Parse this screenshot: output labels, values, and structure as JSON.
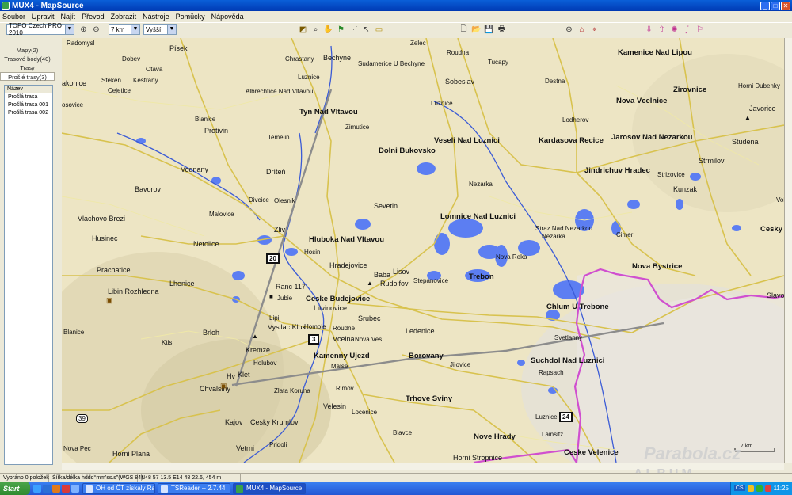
{
  "window": {
    "title": "MUX4 - MapSource",
    "buttons": [
      "_",
      "□",
      "✕"
    ]
  },
  "menu": [
    "Soubor",
    "Upravit",
    "Najít",
    "Převod",
    "Zobrazit",
    "Nástroje",
    "Pomůcky",
    "Nápověda"
  ],
  "toolbar": {
    "map_product": "TOPO Czech PRO 2010",
    "zoom": "7 km",
    "detail": "Vyšší",
    "tools": [
      "zoom-in",
      "zoom-out",
      "map-tool",
      "zoom-tool",
      "hand-tool",
      "waypoint-tool",
      "route-tool",
      "select-tool",
      "measure-tool"
    ],
    "file_tools": [
      "new",
      "open",
      "save",
      "print"
    ],
    "find_tools": [
      "find",
      "find-place",
      "find-nearest"
    ],
    "device_tools": [
      "receive",
      "send",
      "tracks",
      "routes",
      "waypoints"
    ]
  },
  "left_panel": {
    "tabs": [
      "Mapy(2)",
      "Trasové body(40)",
      "Trasy",
      "Prošlé trasy(3)"
    ],
    "list_header": "Název",
    "items": [
      "Prošlá trasa",
      "Prošlá trasa 001",
      "Prošlá trasa 002"
    ]
  },
  "map": {
    "labels": [
      {
        "text": "Radomysl",
        "cls": ""
      },
      {
        "text": "Písek",
        "cls": "big"
      },
      {
        "text": "Dobev",
        "cls": ""
      },
      {
        "text": "Otava",
        "cls": ""
      },
      {
        "text": "Steken",
        "cls": ""
      },
      {
        "text": "Kestrany",
        "cls": ""
      },
      {
        "text": "Cejetice",
        "cls": ""
      },
      {
        "text": "akonice",
        "cls": "big"
      },
      {
        "text": "osovice",
        "cls": ""
      },
      {
        "text": "Blanice",
        "cls": ""
      },
      {
        "text": "Protivin",
        "cls": "big"
      },
      {
        "text": "Temelin",
        "cls": ""
      },
      {
        "text": "Vodnany",
        "cls": "big"
      },
      {
        "text": "Dríteň",
        "cls": "big"
      },
      {
        "text": "Bavorov",
        "cls": "big"
      },
      {
        "text": "Vlachovo Brezi",
        "cls": "big"
      },
      {
        "text": "Husinec",
        "cls": "big"
      },
      {
        "text": "Netolice",
        "cls": "big"
      },
      {
        "text": "Malovice",
        "cls": ""
      },
      {
        "text": "Divcice",
        "cls": ""
      },
      {
        "text": "Olesnik",
        "cls": ""
      },
      {
        "text": "Zliv",
        "cls": "big"
      },
      {
        "text": "Prachatice",
        "cls": "big"
      },
      {
        "text": "Lhenice",
        "cls": "big"
      },
      {
        "text": "Libin Rozhledna",
        "cls": "big"
      },
      {
        "text": "Ranc 117",
        "cls": "big"
      },
      {
        "text": "Jubie",
        "cls": ""
      },
      {
        "text": "Lipi",
        "cls": ""
      },
      {
        "text": "Vysilac Kluk",
        "cls": "big"
      },
      {
        "text": "Brloh",
        "cls": "big"
      },
      {
        "text": "Blanice",
        "cls": ""
      },
      {
        "text": "Ktis",
        "cls": ""
      },
      {
        "text": "Kremze",
        "cls": "big"
      },
      {
        "text": "Holubov",
        "cls": ""
      },
      {
        "text": "Klet",
        "cls": "big"
      },
      {
        "text": "Hv",
        "cls": "big"
      },
      {
        "text": "Chvalsiny",
        "cls": "big"
      },
      {
        "text": "Zlata Koruna",
        "cls": ""
      },
      {
        "text": "Kajov",
        "cls": "big"
      },
      {
        "text": "Cesky Krumlov",
        "cls": "big"
      },
      {
        "text": "Vetrni",
        "cls": "big"
      },
      {
        "text": "Pridoli",
        "cls": ""
      },
      {
        "text": "Horni Plana",
        "cls": "big"
      },
      {
        "text": "Nova Pec",
        "cls": ""
      },
      {
        "text": "Chrastany",
        "cls": ""
      },
      {
        "text": "Bechyne",
        "cls": "big"
      },
      {
        "text": "Sudamerice U Bechyne",
        "cls": ""
      },
      {
        "text": "Luznice",
        "cls": ""
      },
      {
        "text": "Albrechtice Nad Vltavou",
        "cls": ""
      },
      {
        "text": "Tyn Nad Vltavou",
        "cls": "bold"
      },
      {
        "text": "Zimutice",
        "cls": ""
      },
      {
        "text": "Dolni Bukovsko",
        "cls": "bold"
      },
      {
        "text": "Sevetin",
        "cls": "big"
      },
      {
        "text": "Hluboka Nad Vltavou",
        "cls": "bold"
      },
      {
        "text": "Hosin",
        "cls": ""
      },
      {
        "text": "Hradejovice",
        "cls": "big"
      },
      {
        "text": "Baba",
        "cls": "big"
      },
      {
        "text": "Rudolfov",
        "cls": "big"
      },
      {
        "text": "Lisov",
        "cls": "big"
      },
      {
        "text": "Stepanovice",
        "cls": ""
      },
      {
        "text": "Ceske Budejovice",
        "cls": "bold"
      },
      {
        "text": "Litvinovice",
        "cls": "big"
      },
      {
        "text": "Srubec",
        "cls": "big"
      },
      {
        "text": "Homole",
        "cls": ""
      },
      {
        "text": "Roudne",
        "cls": ""
      },
      {
        "text": "Vcelna",
        "cls": "big"
      },
      {
        "text": "Nova Ves",
        "cls": ""
      },
      {
        "text": "Ledenice",
        "cls": "big"
      },
      {
        "text": "Kamenny Ujezd",
        "cls": "bold"
      },
      {
        "text": "Borovany",
        "cls": "bold"
      },
      {
        "text": "Jilovice",
        "cls": ""
      },
      {
        "text": "Malse",
        "cls": ""
      },
      {
        "text": "Rimov",
        "cls": ""
      },
      {
        "text": "Velesin",
        "cls": "big"
      },
      {
        "text": "Locenice",
        "cls": ""
      },
      {
        "text": "Trhove Sviny",
        "cls": "bold"
      },
      {
        "text": "Blavce",
        "cls": ""
      },
      {
        "text": "Nove Hrady",
        "cls": "bold"
      },
      {
        "text": "Horni Stropnice",
        "cls": "big"
      },
      {
        "text": "Zelec",
        "cls": ""
      },
      {
        "text": "Roudna",
        "cls": ""
      },
      {
        "text": "Tucapy",
        "cls": ""
      },
      {
        "text": "Sobeslav",
        "cls": "big"
      },
      {
        "text": "Destna",
        "cls": ""
      },
      {
        "text": "Luznice",
        "cls": ""
      },
      {
        "text": "Veseli Nad Luznici",
        "cls": "bold"
      },
      {
        "text": "Kardasova Recice",
        "cls": "bold"
      },
      {
        "text": "Lodherov",
        "cls": ""
      },
      {
        "text": "Nezarka",
        "cls": ""
      },
      {
        "text": "Lomnice Nad Luznici",
        "cls": "bold"
      },
      {
        "text": "Straz Nad Nezarkou",
        "cls": ""
      },
      {
        "text": "Nezarka",
        "cls": ""
      },
      {
        "text": "Nova Reka",
        "cls": ""
      },
      {
        "text": "Trebon",
        "cls": "bold"
      },
      {
        "text": "Chlum U Trebone",
        "cls": "bold"
      },
      {
        "text": "Svetlanny",
        "cls": ""
      },
      {
        "text": "Suchdol Nad Luznici",
        "cls": "bold"
      },
      {
        "text": "Rapsach",
        "cls": ""
      },
      {
        "text": "Luznice",
        "cls": ""
      },
      {
        "text": "Lainsitz",
        "cls": ""
      },
      {
        "text": "Ceske Velenice",
        "cls": "bold"
      },
      {
        "text": "Kamenice Nad Lipou",
        "cls": "bold"
      },
      {
        "text": "Zirovnice",
        "cls": "bold"
      },
      {
        "text": "Nova Vcelnice",
        "cls": "bold"
      },
      {
        "text": "Horni Dubenky",
        "cls": ""
      },
      {
        "text": "Javorice",
        "cls": "big"
      },
      {
        "text": "Jarosov Nad Nezarkou",
        "cls": "bold"
      },
      {
        "text": "Studena",
        "cls": "big"
      },
      {
        "text": "Strmilov",
        "cls": "big"
      },
      {
        "text": "Jindrichuv Hradec",
        "cls": "bold"
      },
      {
        "text": "Strizovice",
        "cls": ""
      },
      {
        "text": "Kunzak",
        "cls": "big"
      },
      {
        "text": "Volfirov",
        "cls": ""
      },
      {
        "text": "Cimer",
        "cls": ""
      },
      {
        "text": "Cesky Rudol",
        "cls": "bold"
      },
      {
        "text": "Nova Bystrice",
        "cls": "bold"
      },
      {
        "text": "Slavonice",
        "cls": "big"
      }
    ],
    "route_shields": [
      "20",
      "3",
      "39",
      "24"
    ],
    "scale_label": "7 km",
    "watermark_main": "Parabola.cz",
    "watermark_sub": "ALBUM"
  },
  "status": {
    "selection": "Vybráno 0 položek",
    "format": "Šířka/délka hddd°mm'ss.s\"(WGS 84)",
    "coords": "N48 57 13.5 E14 48 22.6, 454 m"
  },
  "taskbar": {
    "start": "Start",
    "tasks": [
      "OH od ČT získaly Ra...",
      "TSReader -- 2.7.44",
      "MUX4 - MapSource"
    ],
    "clock": "11:25",
    "lang": "CS"
  }
}
